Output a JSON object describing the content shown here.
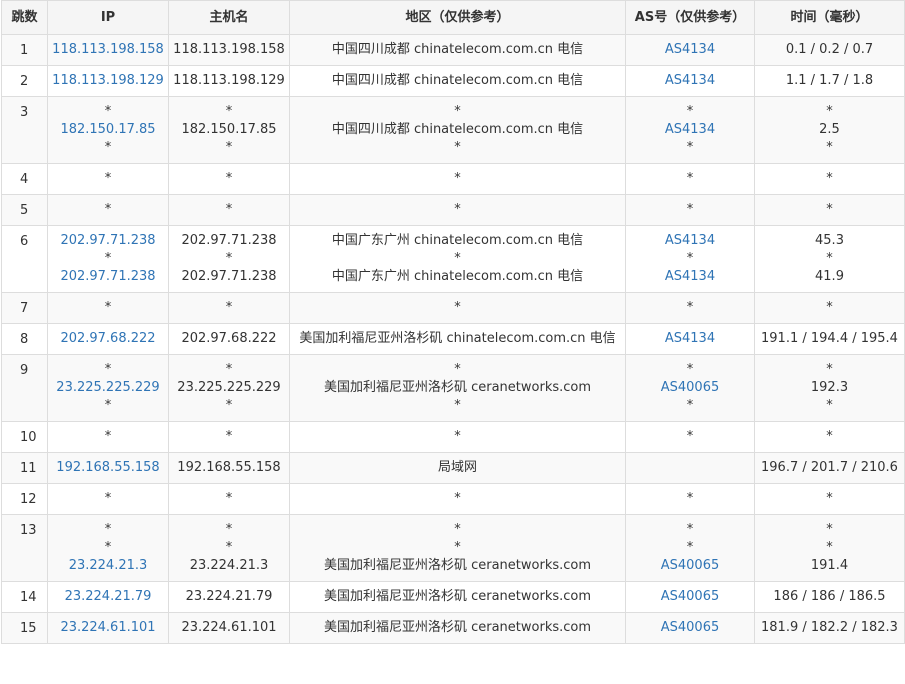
{
  "headers": [
    "跳数",
    "IP",
    "主机名",
    "地区（仅供参考）",
    "AS号（仅供参考）",
    "时间（毫秒）"
  ],
  "rows": [
    {
      "hop": "1",
      "ip": [
        "118.113.198.158"
      ],
      "host": [
        "118.113.198.158"
      ],
      "region": [
        "中国四川成都 chinatelecom.com.cn 电信"
      ],
      "as": [
        "AS4134"
      ],
      "time": [
        "0.1 / 0.2 / 0.7"
      ]
    },
    {
      "hop": "2",
      "ip": [
        "118.113.198.129"
      ],
      "host": [
        "118.113.198.129"
      ],
      "region": [
        "中国四川成都 chinatelecom.com.cn 电信"
      ],
      "as": [
        "AS4134"
      ],
      "time": [
        "1.1 / 1.7 / 1.8"
      ]
    },
    {
      "hop": "3",
      "ip": [
        "*",
        "182.150.17.85",
        "*"
      ],
      "host": [
        "*",
        "182.150.17.85",
        "*"
      ],
      "region": [
        "*",
        "中国四川成都 chinatelecom.com.cn 电信",
        "*"
      ],
      "as": [
        "*",
        "AS4134",
        "*"
      ],
      "time": [
        "*",
        "2.5",
        "*"
      ]
    },
    {
      "hop": "4",
      "ip": [
        "*"
      ],
      "host": [
        "*"
      ],
      "region": [
        "*"
      ],
      "as": [
        "*"
      ],
      "time": [
        "*"
      ]
    },
    {
      "hop": "5",
      "ip": [
        "*"
      ],
      "host": [
        "*"
      ],
      "region": [
        "*"
      ],
      "as": [
        "*"
      ],
      "time": [
        "*"
      ]
    },
    {
      "hop": "6",
      "ip": [
        "202.97.71.238",
        "*",
        "202.97.71.238"
      ],
      "host": [
        "202.97.71.238",
        "*",
        "202.97.71.238"
      ],
      "region": [
        "中国广东广州 chinatelecom.com.cn 电信",
        "*",
        "中国广东广州 chinatelecom.com.cn 电信"
      ],
      "as": [
        "AS4134",
        "*",
        "AS4134"
      ],
      "time": [
        "45.3",
        "*",
        "41.9"
      ]
    },
    {
      "hop": "7",
      "ip": [
        "*"
      ],
      "host": [
        "*"
      ],
      "region": [
        "*"
      ],
      "as": [
        "*"
      ],
      "time": [
        "*"
      ]
    },
    {
      "hop": "8",
      "ip": [
        "202.97.68.222"
      ],
      "host": [
        "202.97.68.222"
      ],
      "region": [
        "美国加利福尼亚州洛杉矶 chinatelecom.com.cn 电信"
      ],
      "as": [
        "AS4134"
      ],
      "time": [
        "191.1 / 194.4 / 195.4"
      ]
    },
    {
      "hop": "9",
      "ip": [
        "*",
        "23.225.225.229",
        "*"
      ],
      "host": [
        "*",
        "23.225.225.229",
        "*"
      ],
      "region": [
        "*",
        "美国加利福尼亚州洛杉矶 ceranetworks.com",
        "*"
      ],
      "as": [
        "*",
        "AS40065",
        "*"
      ],
      "time": [
        "*",
        "192.3",
        "*"
      ]
    },
    {
      "hop": "10",
      "ip": [
        "*"
      ],
      "host": [
        "*"
      ],
      "region": [
        "*"
      ],
      "as": [
        "*"
      ],
      "time": [
        "*"
      ]
    },
    {
      "hop": "11",
      "ip": [
        "192.168.55.158"
      ],
      "host": [
        "192.168.55.158"
      ],
      "region": [
        "局域网"
      ],
      "as": [
        ""
      ],
      "time": [
        "196.7 / 201.7 / 210.6"
      ]
    },
    {
      "hop": "12",
      "ip": [
        "*"
      ],
      "host": [
        "*"
      ],
      "region": [
        "*"
      ],
      "as": [
        "*"
      ],
      "time": [
        "*"
      ]
    },
    {
      "hop": "13",
      "ip": [
        "*",
        "*",
        "23.224.21.3"
      ],
      "host": [
        "*",
        "*",
        "23.224.21.3"
      ],
      "region": [
        "*",
        "*",
        "美国加利福尼亚州洛杉矶 ceranetworks.com"
      ],
      "as": [
        "*",
        "*",
        "AS40065"
      ],
      "time": [
        "*",
        "*",
        "191.4"
      ]
    },
    {
      "hop": "14",
      "ip": [
        "23.224.21.79"
      ],
      "host": [
        "23.224.21.79"
      ],
      "region": [
        "美国加利福尼亚州洛杉矶 ceranetworks.com"
      ],
      "as": [
        "AS40065"
      ],
      "time": [
        "186 / 186 / 186.5"
      ]
    },
    {
      "hop": "15",
      "ip": [
        "23.224.61.101"
      ],
      "host": [
        "23.224.61.101"
      ],
      "region": [
        "美国加利福尼亚州洛杉矶 ceranetworks.com"
      ],
      "as": [
        "AS40065"
      ],
      "time": [
        "181.9 / 182.2 / 182.3"
      ]
    }
  ],
  "colors": {
    "link": "#2f74b5",
    "border": "#dddddd",
    "header_bg": "#f5f5f5",
    "stripe": "#f9f9f9"
  }
}
